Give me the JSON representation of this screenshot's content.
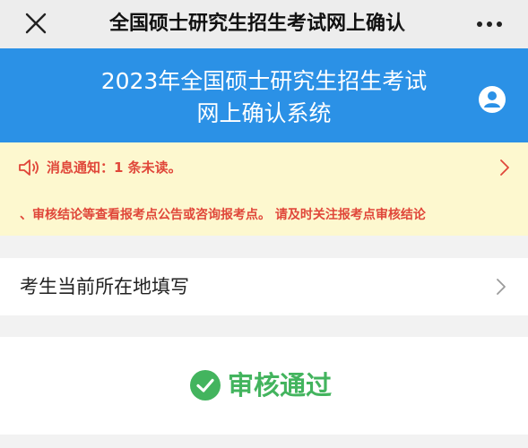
{
  "navbar": {
    "close_icon": "close-icon",
    "title": "全国硕士研究生招生考试网上确认",
    "more_icon": "more-horizontal-icon"
  },
  "header": {
    "title_line1": "2023年全国硕士研究生招生考试",
    "title_line2": "网上确认系统",
    "user_icon": "user-icon"
  },
  "notice": {
    "speaker_icon": "speaker-icon",
    "heading": "消息通知：1 条未读。",
    "chevron_icon": "chevron-right-icon",
    "scroll_text": "、审核结论等查看报考点公告或咨询报考点。 请及时关注报考点审核结论"
  },
  "location": {
    "label": "考生当前所在地填写",
    "chevron_icon": "chevron-right-icon"
  },
  "status": {
    "icon": "check-circle-icon",
    "text": "审核通过"
  },
  "colors": {
    "header_blue": "#2b91e6",
    "notice_bg": "#fdf8cf",
    "notice_red": "#e0473a",
    "success_green": "#43b45e",
    "page_bg": "#f2f2f2"
  }
}
